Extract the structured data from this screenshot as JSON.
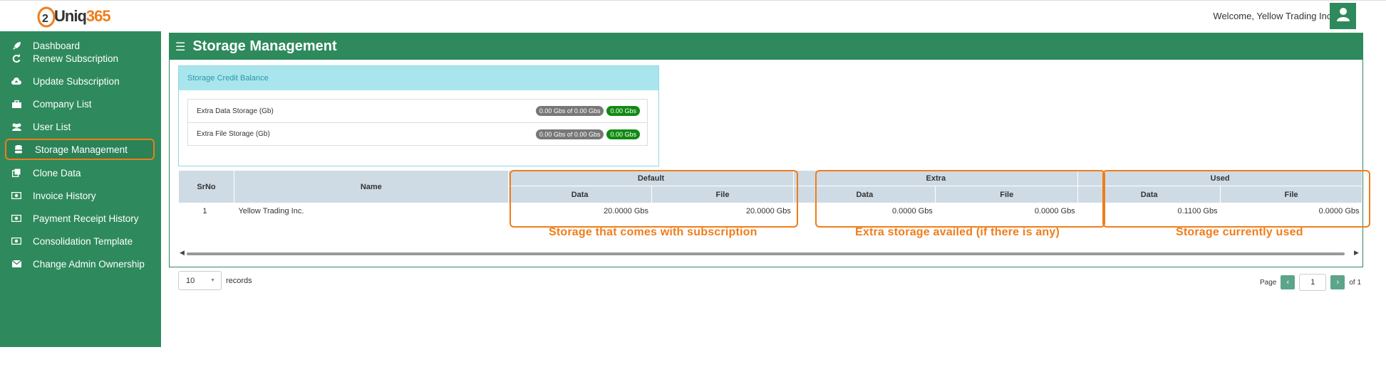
{
  "brand": {
    "logo_prefix": "Uniq",
    "logo_number": "365",
    "accent": "#f07d1a",
    "primary": "#2e8a5c"
  },
  "header": {
    "welcome": "Welcome, Yellow Trading Inc.",
    "avatar_icon": "user-icon"
  },
  "sidebar": {
    "items": [
      {
        "label": "Dashboard",
        "icon": "rocket-icon"
      },
      {
        "label": "Renew Subscription",
        "icon": "refresh-icon"
      },
      {
        "label": "Update Subscription",
        "icon": "cloud-upload-icon"
      },
      {
        "label": "Company List",
        "icon": "briefcase-icon"
      },
      {
        "label": "User List",
        "icon": "users-icon"
      },
      {
        "label": "Storage Management",
        "icon": "database-icon",
        "active": true
      },
      {
        "label": "Clone Data",
        "icon": "clone-icon"
      },
      {
        "label": "Invoice History",
        "icon": "money-icon"
      },
      {
        "label": "Payment Receipt History",
        "icon": "money-icon"
      },
      {
        "label": "Consolidation Template",
        "icon": "money-icon"
      },
      {
        "label": "Change Admin Ownership",
        "icon": "envelope-icon"
      }
    ]
  },
  "page": {
    "title": "Storage Management"
  },
  "credit": {
    "title": "Storage Credit Balance",
    "rows": [
      {
        "label": "Extra Data Storage (Gb)",
        "usage": "0.00 Gbs of 0.00 Gbs",
        "balance": "0.00 Gbs"
      },
      {
        "label": "Extra File Storage (Gb)",
        "usage": "0.00 Gbs of 0.00 Gbs",
        "balance": "0.00 Gbs"
      }
    ]
  },
  "table": {
    "headers": {
      "srno": "SrNo",
      "name": "Name",
      "default": "Default",
      "extra": "Extra",
      "used": "Used",
      "data": "Data",
      "file": "File"
    },
    "row": {
      "srno": "1",
      "name": "Yellow Trading Inc.",
      "default_data": "20.0000 Gbs",
      "default_file": "20.0000 Gbs",
      "extra_data": "0.0000 Gbs",
      "extra_file": "0.0000 Gbs",
      "used_data": "0.1100 Gbs",
      "used_file": "0.0000 Gbs"
    }
  },
  "pagination": {
    "page_size": "10",
    "records_label": "records",
    "page_label": "Page",
    "current_page": "1",
    "of_label": "of 1"
  },
  "annotations": {
    "default_note": "Storage that comes with subscription",
    "extra_note": "Extra storage availed  (if there is any)",
    "used_note": "Storage currently used"
  }
}
